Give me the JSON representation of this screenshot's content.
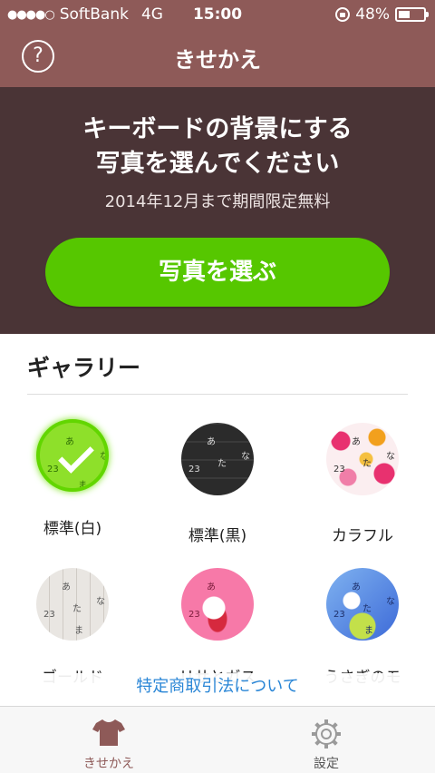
{
  "status": {
    "carrier": "SoftBank",
    "network": "4G",
    "time": "15:00",
    "battery": "48%",
    "battery_level": 0.48
  },
  "nav": {
    "title": "きせかえ",
    "help_label": "?"
  },
  "hero": {
    "title_line1": "キーボードの背景にする",
    "title_line2": "写真を選んでください",
    "subtitle": "2014年12月まで期間限定無料",
    "button_label": "写真を選ぶ"
  },
  "gallery": {
    "title": "ギャラリー",
    "items": [
      {
        "label": "標準(白)",
        "selected": true
      },
      {
        "label": "標準(黒)",
        "selected": false
      },
      {
        "label": "カラフル",
        "selected": false
      },
      {
        "label": "ゴールド",
        "selected": false
      },
      {
        "label": "リサとガス",
        "selected": false
      },
      {
        "label": "うさぎのモ",
        "selected": false
      }
    ],
    "keyboard_chars": [
      "あ",
      "た",
      "な",
      "23",
      "ま"
    ]
  },
  "legal_link": "特定商取引法について",
  "tabs": [
    {
      "label": "きせかえ",
      "icon": "shirt-icon",
      "active": true
    },
    {
      "label": "設定",
      "icon": "gear-icon",
      "active": false
    }
  ],
  "colors": {
    "brand": "#8e5a58",
    "hero_bg": "#4a3436",
    "accent_green": "#56c700",
    "link_blue": "#2a86d6"
  }
}
